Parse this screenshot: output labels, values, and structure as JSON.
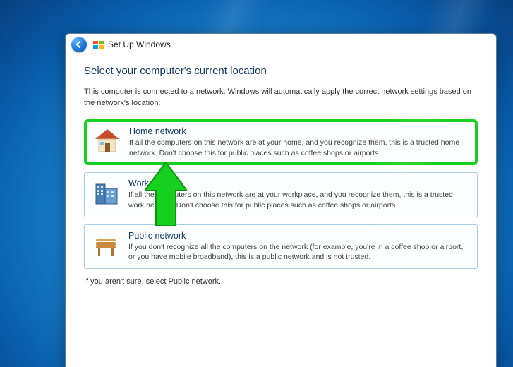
{
  "window": {
    "title": "Set Up Windows"
  },
  "page": {
    "heading": "Select your computer's current location",
    "intro": "This computer is connected to a network. Windows will automatically apply the correct network settings based on the network's location.",
    "footer": "If you aren't sure, select Public network."
  },
  "options": {
    "home": {
      "title": "Home network",
      "desc": "If all the computers on this network are at your home, and you recognize them, this is a trusted home network.  Don't choose this for public places such as coffee shops or airports."
    },
    "work": {
      "title": "Work network",
      "desc": "If all the computers on this network are at your workplace, and you recognize them, this is a trusted work network.  Don't choose this for public places such as coffee shops or airports."
    },
    "public": {
      "title": "Public network",
      "desc": "If you don't recognize all the computers on the network (for example, you're in a coffee shop or airport, or you have mobile broadband), this is a public network and is not trusted."
    }
  },
  "colors": {
    "highlight": "#17cf1e",
    "heading": "#103a68",
    "option_title": "#0f3c6e"
  }
}
